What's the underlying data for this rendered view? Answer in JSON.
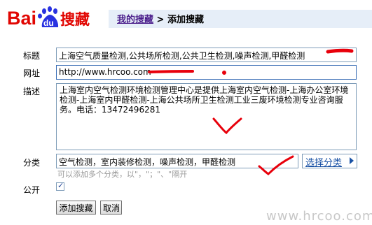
{
  "logo": {
    "text_left": "Bai",
    "text_du": "du",
    "text_right": "搜藏"
  },
  "breadcrumb": {
    "parent": "我的搜藏",
    "separator": ">",
    "current": "添加搜藏"
  },
  "form": {
    "title": {
      "label": "标题",
      "value": "上海空气质量检测,公共场所检测,公共卫生检测,噪声检测,甲醛检测"
    },
    "url": {
      "label": "网址",
      "value": "http://www.hrcoo.com"
    },
    "description": {
      "label": "描述",
      "value": "上海室内空气检测环境检测管理中心是提供上海室内空气检测-上海办公室环境检测-上海室内甲醛检测-上海公共场所卫生检测工业三废环境检测专业咨询服务。电话：13472496281"
    },
    "category": {
      "label": "分类",
      "value": "空气检测，室内装修检测，噪声检测，甲醛检测",
      "choose_label": "选择分类",
      "hint": "可以添加多个分类，以\"，\"；\"、\"隔开"
    },
    "public": {
      "label": "公开",
      "checked": true
    }
  },
  "buttons": {
    "submit": "添加搜藏",
    "cancel": "取消"
  },
  "watermark": "www.hrcoo.com",
  "colors": {
    "logo_red": "#e10602",
    "logo_blue": "#2932e1",
    "link": "#4a1d8b",
    "annotation": "#e8000b"
  }
}
